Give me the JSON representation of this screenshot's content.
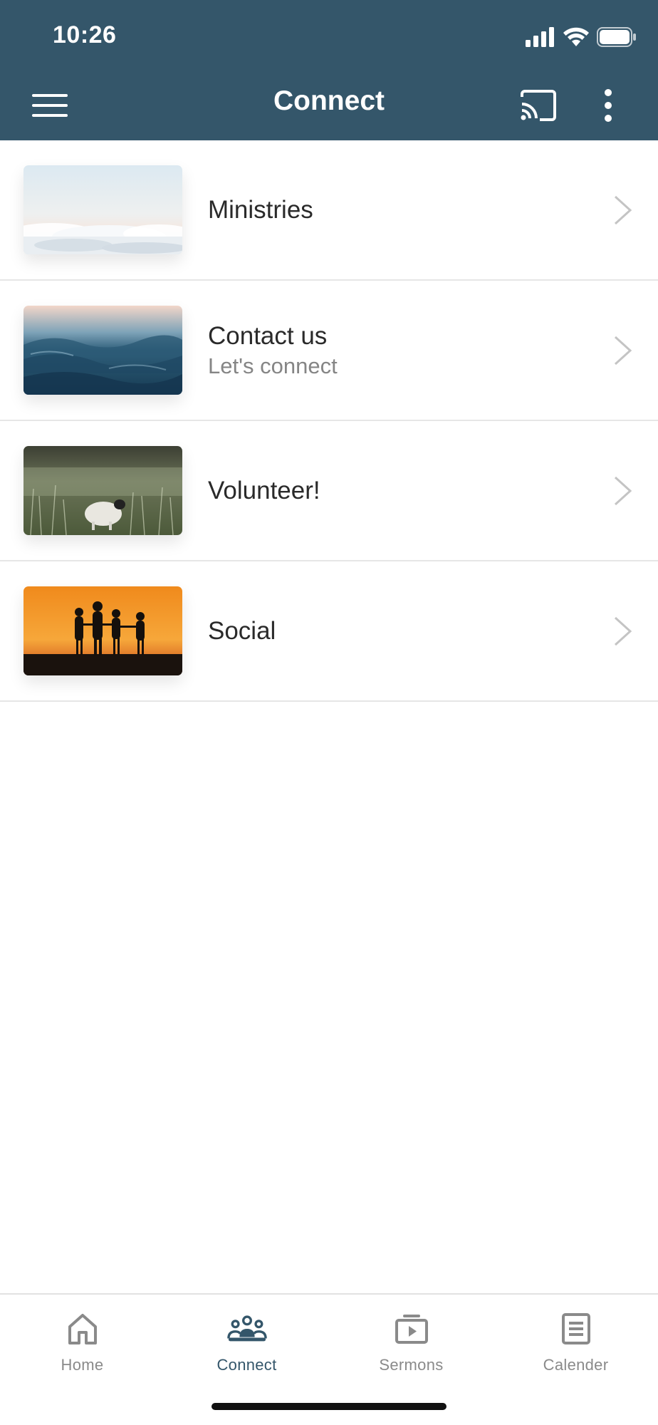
{
  "status_bar": {
    "time": "10:26"
  },
  "app_bar": {
    "title": "Connect"
  },
  "list": {
    "items": [
      {
        "title": "Ministries",
        "subtitle": "",
        "image": "clouds-image"
      },
      {
        "title": "Contact us",
        "subtitle": "Let's connect",
        "image": "ocean-waves-image"
      },
      {
        "title": "Volunteer!",
        "subtitle": "",
        "image": "meadow-sheep-image"
      },
      {
        "title": "Social",
        "subtitle": "",
        "image": "sunset-silhouettes-image"
      }
    ]
  },
  "bottom_nav": {
    "tabs": [
      {
        "label": "Home",
        "icon": "home-icon",
        "active": false
      },
      {
        "label": "Connect",
        "icon": "people-icon",
        "active": true
      },
      {
        "label": "Sermons",
        "icon": "play-tv-icon",
        "active": false
      },
      {
        "label": "Calender",
        "icon": "calendar-icon",
        "active": false
      }
    ]
  },
  "colors": {
    "app_bar": "#34566a",
    "active_tab": "#34566a",
    "inactive_tab": "#8a8a8a"
  }
}
